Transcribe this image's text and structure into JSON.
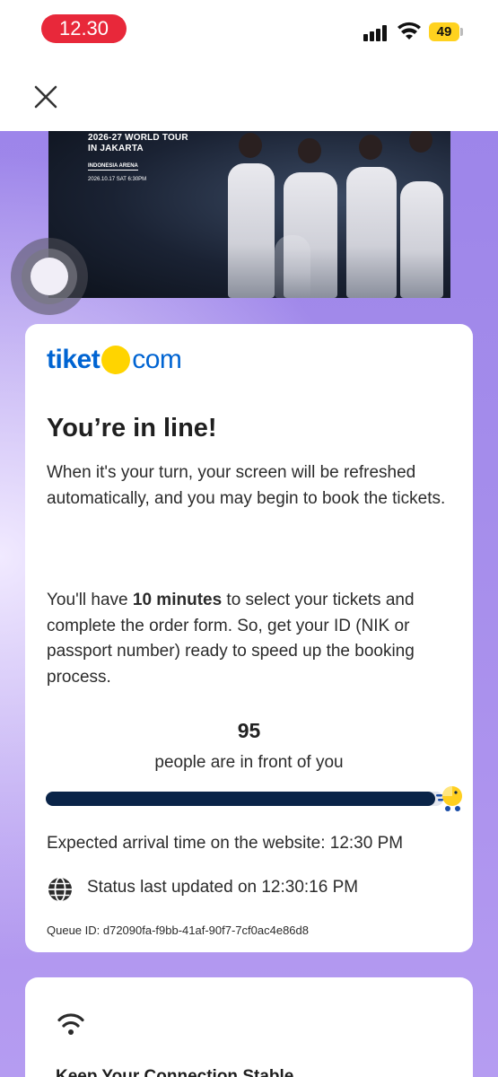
{
  "status_bar": {
    "time": "12.30",
    "battery": "49"
  },
  "banner": {
    "title_line1": "2026-27 WORLD TOUR",
    "title_line2": "IN JAKARTA",
    "venue": "INDONESIA ARENA",
    "date": "2026.10.17 SAT 6:30PM"
  },
  "card": {
    "logo_part1": "tiket",
    "logo_part2": "com",
    "heading": "You’re in line!",
    "paragraph1": "When it's your turn, your screen will be refreshed automatically, and you may begin to book the tickets.",
    "paragraph2_pre": "You'll have ",
    "paragraph2_bold": "10 minutes",
    "paragraph2_post": " to select your tickets and complete the order form. So, get your ID (NIK or passport number) ready to speed up the booking process.",
    "people_count": "95",
    "people_label": "people are in front of you",
    "progress_fraction": 0.98,
    "eta": "Expected arrival time on the website: 12:30 PM",
    "status_updated": "Status last updated on 12:30:16 PM",
    "queue_id": "Queue ID: d72090fa-f9bb-41af-90f7-7cf0ac4e86d8"
  },
  "card2": {
    "title": "Keep Your Connection Stable"
  },
  "colors": {
    "time_pill": "#e8283a",
    "battery": "#ffd21f",
    "brand_blue": "#0064d2",
    "brand_yellow": "#ffd400",
    "progress_fill": "#0a2448",
    "background_purple": "#a58deb"
  },
  "icons": [
    "close-icon",
    "signal-icon",
    "wifi-icon",
    "globe-icon",
    "assistive-touch-icon",
    "runner-icon"
  ]
}
